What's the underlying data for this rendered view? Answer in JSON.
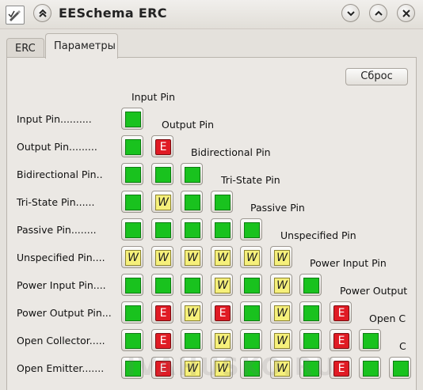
{
  "window": {
    "title": "EESchema ERC",
    "watermark": "IVAHUSKO.RU"
  },
  "tabs": [
    {
      "label": "ERC",
      "active": false
    },
    {
      "label": "Параметры",
      "active": true
    }
  ],
  "reset_label": "Сброс",
  "pins": [
    {
      "row_label": "Input Pin..........",
      "col_label": "Input Pin"
    },
    {
      "row_label": "Output Pin.........",
      "col_label": "Output Pin"
    },
    {
      "row_label": "Bidirectional Pin..",
      "col_label": "Bidirectional Pin"
    },
    {
      "row_label": "Tri-State Pin......",
      "col_label": "Tri-State Pin"
    },
    {
      "row_label": "Passive Pin........",
      "col_label": "Passive Pin"
    },
    {
      "row_label": "Unspecified Pin....",
      "col_label": "Unspecified Pin"
    },
    {
      "row_label": "Power Input Pin....",
      "col_label": "Power Input Pin"
    },
    {
      "row_label": "Power Output Pin...",
      "col_label": "Power Output"
    },
    {
      "row_label": "Open Collector.....",
      "col_label": "Open C"
    },
    {
      "row_label": "Open Emitter.......",
      "col_label": "C"
    }
  ],
  "matrix": [
    [
      "ok"
    ],
    [
      "ok",
      "err"
    ],
    [
      "ok",
      "ok",
      "ok"
    ],
    [
      "ok",
      "warn",
      "ok",
      "ok"
    ],
    [
      "ok",
      "ok",
      "ok",
      "ok",
      "ok"
    ],
    [
      "warn",
      "warn",
      "warn",
      "warn",
      "warn",
      "warn"
    ],
    [
      "ok",
      "ok",
      "ok",
      "warn",
      "ok",
      "warn",
      "ok"
    ],
    [
      "ok",
      "err",
      "warn",
      "err",
      "ok",
      "warn",
      "ok",
      "err"
    ],
    [
      "ok",
      "err",
      "ok",
      "warn",
      "ok",
      "warn",
      "ok",
      "err",
      "ok"
    ],
    [
      "ok",
      "err",
      "warn",
      "warn",
      "ok",
      "warn",
      "ok",
      "err",
      "ok",
      "ok"
    ]
  ],
  "markers": {
    "err": "E",
    "warn": "W",
    "ok": ""
  },
  "colors": {
    "ok": "#19c21e",
    "err": "#e01b24",
    "warn": "#f6f07a"
  },
  "icons": [
    "app-edit-icon",
    "shade-up-icon",
    "minimize-icon",
    "maximize-icon",
    "close-icon"
  ]
}
